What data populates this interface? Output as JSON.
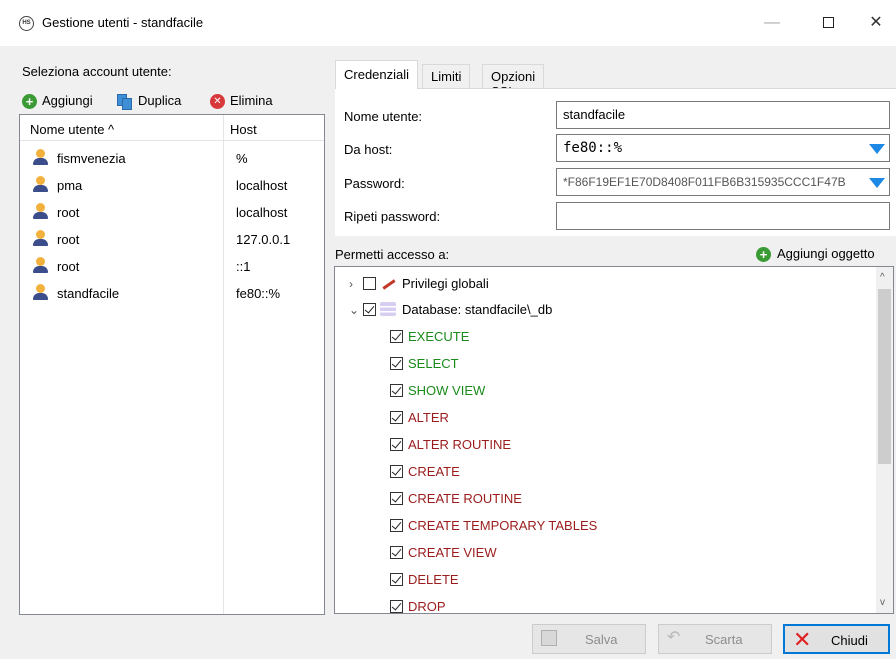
{
  "window": {
    "title": "Gestione utenti - standfacile",
    "app_icon": "HS",
    "controls": {
      "minimize": "—",
      "maximize": "☐",
      "close": "✕"
    }
  },
  "left": {
    "select_label": "Seleziona account utente:",
    "toolbar": {
      "add": "Aggiungi",
      "duplicate": "Duplica",
      "delete": "Elimina"
    },
    "columns": {
      "name": "Nome utente ^",
      "host": "Host"
    },
    "users": [
      {
        "name": "fismvenezia",
        "host": "%"
      },
      {
        "name": "pma",
        "host": "localhost"
      },
      {
        "name": "root",
        "host": "localhost"
      },
      {
        "name": "root",
        "host": "127.0.0.1"
      },
      {
        "name": "root",
        "host": "::1"
      },
      {
        "name": "standfacile",
        "host": "fe80::%"
      }
    ]
  },
  "tabs": [
    {
      "label": "Credenziali",
      "active": true
    },
    {
      "label": "Limiti",
      "active": false
    },
    {
      "label": "Opzioni SSL",
      "active": false
    }
  ],
  "credentials": {
    "username_label": "Nome utente:",
    "username_value": "standfacile",
    "host_label": "Da host:",
    "host_value": "fe80::%",
    "password_label": "Password:",
    "password_value": "*F86F19EF1E70D8408F011FB6B315935CCC1F47B",
    "repeat_label": "Ripeti password:",
    "repeat_value": ""
  },
  "permissions": {
    "label": "Permetti accesso a:",
    "add_object": "Aggiungi oggetto",
    "global": "Privilegi globali",
    "database": "Database: standfacile\\_db",
    "privileges": [
      {
        "name": "EXECUTE",
        "color": "#1a8a1a"
      },
      {
        "name": "SELECT",
        "color": "#1a8a1a"
      },
      {
        "name": "SHOW VIEW",
        "color": "#1a8a1a"
      },
      {
        "name": "ALTER",
        "color": "#9b1c1c"
      },
      {
        "name": "ALTER ROUTINE",
        "color": "#9b1c1c"
      },
      {
        "name": "CREATE",
        "color": "#9b1c1c"
      },
      {
        "name": "CREATE ROUTINE",
        "color": "#9b1c1c"
      },
      {
        "name": "CREATE TEMPORARY TABLES",
        "color": "#9b1c1c"
      },
      {
        "name": "CREATE VIEW",
        "color": "#9b1c1c"
      },
      {
        "name": "DELETE",
        "color": "#9b1c1c"
      },
      {
        "name": "DROP",
        "color": "#9b1c1c"
      }
    ]
  },
  "buttons": {
    "save": "Salva",
    "discard": "Scarta",
    "close": "Chiudi"
  }
}
